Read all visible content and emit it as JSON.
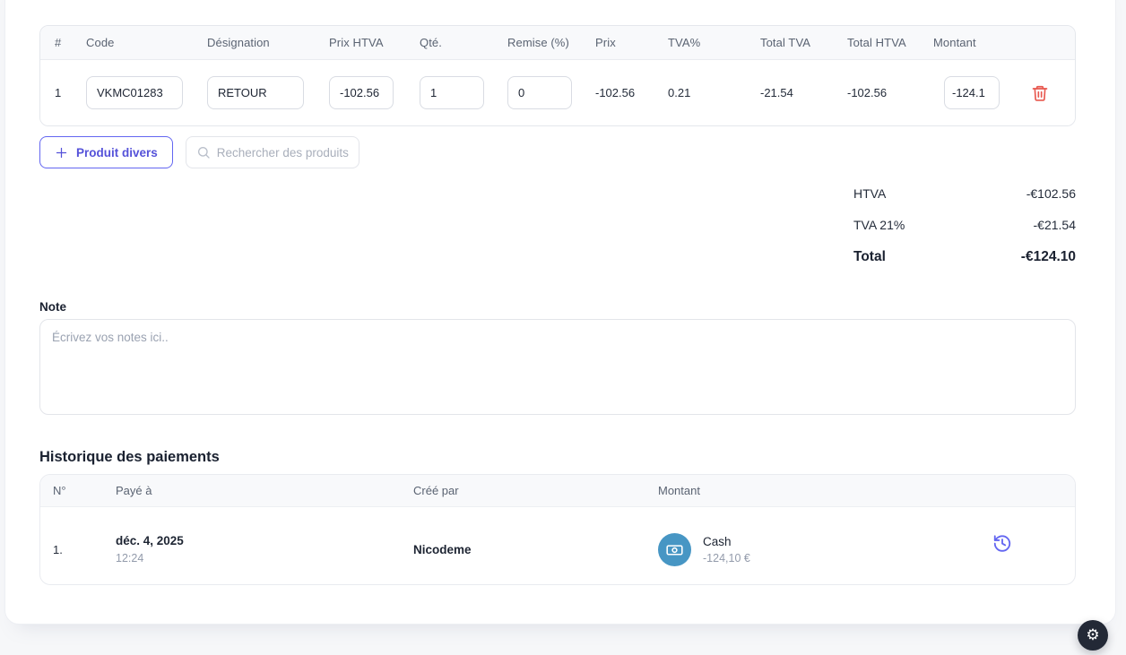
{
  "colors": {
    "accent_indigo": "#6366f1",
    "danger_red": "#e8584f",
    "cash_icon_bg": "#4796c4",
    "fab_bg": "#232936",
    "table_header_bg": "#f8f9fb"
  },
  "icons": {
    "gear_glyph": "⚙",
    "names": [
      "plus-icon",
      "search-icon",
      "trash-icon",
      "banknote-icon",
      "history-icon",
      "gear-icon"
    ]
  },
  "line_items": {
    "headers": [
      "#",
      "Code",
      "Désignation",
      "Prix HTVA",
      "Qté.",
      "Remise (%)",
      "Prix",
      "TVA%",
      "Total TVA",
      "Total HTVA",
      "Montant"
    ],
    "row": {
      "num": "1",
      "code": "VKMC01283",
      "designation": "RETOUR",
      "prix_htva": "-102.56",
      "qte": "1",
      "remise": "0",
      "prix": "-102.56",
      "tva_pct": "0.21",
      "total_tva": "-21.54",
      "total_htva": "-102.56",
      "montant": "-124.1"
    }
  },
  "actions": {
    "add_product_label": "Produit divers",
    "search_placeholder": "Rechercher des produits"
  },
  "totals": {
    "rows": [
      {
        "label": "HTVA",
        "value": "-€102.56"
      },
      {
        "label": "TVA 21%",
        "value": "-€21.54"
      },
      {
        "label": "Total",
        "value": "-€124.10"
      }
    ]
  },
  "note": {
    "label": "Note",
    "placeholder": "Écrivez vos notes ici.."
  },
  "payments": {
    "title": "Historique des paiements",
    "headers": [
      "N°",
      "Payé à",
      "Créé par",
      "Montant"
    ],
    "row": {
      "num": "1.",
      "date": "déc. 4, 2025",
      "time": "12:24",
      "created_by": "Nicodeme",
      "method": "Cash",
      "amount": "-124,10 €"
    }
  }
}
